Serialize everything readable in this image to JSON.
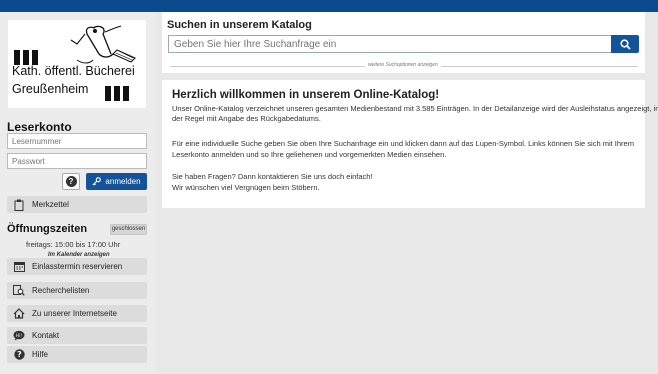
{
  "logo": {
    "line1": "Kath. öffentl. Bücherei",
    "line2": "Greußenheim"
  },
  "login": {
    "heading": "Leserkonto",
    "username_placeholder": "Lesernummer",
    "password_placeholder": "Passwort",
    "submit_label": "anmelden"
  },
  "sidebar": {
    "bookmarks_label": "Merkzettel",
    "hours_heading": "Öffnungszeiten",
    "closed_badge": "geschlossen",
    "hours_text": "freitags:   15:00 bis 17:00 Uhr",
    "calendar_link": "Im Kalender anzeigen",
    "items": [
      {
        "label": "Einlasstermin reservieren",
        "icon": "calendar-icon"
      },
      {
        "label": "Recherchelisten",
        "icon": "search-list-icon"
      },
      {
        "label": "Zu unserer Internetseite",
        "icon": "home-icon"
      },
      {
        "label": "Kontakt",
        "icon": "chat-icon"
      },
      {
        "label": "Hilfe",
        "icon": "help-icon"
      }
    ]
  },
  "search": {
    "title": "Suchen in unserem Katalog",
    "placeholder": "Geben Sie hier Ihre Suchanfrage ein",
    "more_options": "weitere Suchoptionen anzeigen"
  },
  "welcome": {
    "title": "Herzlich willkommen in unserem Online-Katalog!",
    "p1_line1": "Unser Online-Katalog verzeichnet unseren gesamten Medienbestand mit 3.585 Einträgen. In der Detailanzeige wird der Ausleihstatus angezeigt, in",
    "p1_line2": "der Regel mit Angabe des Rückgabedatums.",
    "p2_line1": "Für eine individuelle Suche geben Sie oben Ihre Suchanfrage ein und klicken dann auf das Lupen-Symbol. Links können Sie sich mit Ihrem",
    "p2_line2": "Leserkonto anmelden und so Ihre geliehenen und vorgemerkten Medien einsehen.",
    "p3_line1": "Sie haben Fragen? Dann kontaktieren Sie uns doch einfach!",
    "p3_line2": "Wir wünschen viel Vergnügen beim Stöbern."
  },
  "colors": {
    "top_bar": "#0c4a8f",
    "primary_button": "#14529a"
  }
}
